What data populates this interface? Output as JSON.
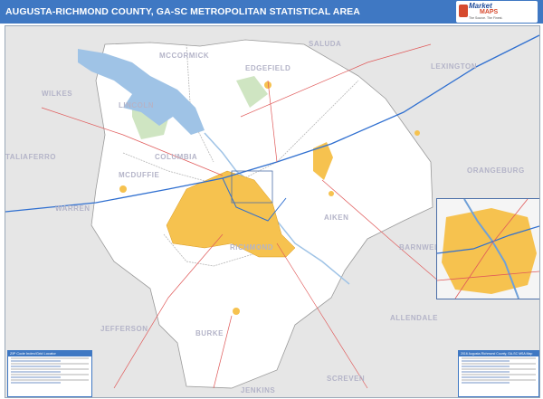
{
  "header": {
    "title": "AUGUSTA-RICHMOND COUNTY, GA-SC METROPOLITAN STATISTICAL AREA"
  },
  "logo": {
    "word1": "Market",
    "word2": "MAPS",
    "tagline": "The Source. The Finest.",
    "brand_color": "#234f9c",
    "accent_color": "#d64a2e"
  },
  "colors": {
    "title_bar": "#3f78c3",
    "msa_counties": "#ffffff",
    "outside_counties": "#e6e6e6",
    "urban_area": "#f6c24f",
    "water": "#9fc3e6",
    "forest": "#cfe5c2",
    "interstate": "#2f6fd0",
    "highway": "#e05a5a"
  },
  "map": {
    "counties_outside": [
      {
        "id": "mccormick",
        "label": "MCCORMICK"
      },
      {
        "id": "saluda",
        "label": "SALUDA"
      },
      {
        "id": "lexington",
        "label": "LEXINGTON"
      },
      {
        "id": "wilkes",
        "label": "WILKES"
      },
      {
        "id": "taliaferro",
        "label": "TALIAFERRO"
      },
      {
        "id": "warren",
        "label": "WARREN"
      },
      {
        "id": "orangeburg",
        "label": "ORANGEBURG"
      },
      {
        "id": "barnwell",
        "label": "BARNWELL"
      },
      {
        "id": "allendale",
        "label": "ALLENDALE"
      },
      {
        "id": "jefferson",
        "label": "JEFFERSON"
      },
      {
        "id": "screven",
        "label": "SCREVEN"
      },
      {
        "id": "jenkins",
        "label": "JENKINS"
      },
      {
        "id": "lincoln",
        "label": "LINCOLN"
      }
    ],
    "counties_msa": [
      {
        "id": "edgefield",
        "label": "EDGEFIELD"
      },
      {
        "id": "columbia",
        "label": "COLUMBIA"
      },
      {
        "id": "mcduffie",
        "label": "MCDUFFIE"
      },
      {
        "id": "richmond",
        "label": "RICHMOND"
      },
      {
        "id": "aiken",
        "label": "AIKEN"
      },
      {
        "id": "burke",
        "label": "BURKE"
      }
    ]
  },
  "legend_left": {
    "heading": "ZIP Code Index/Grid Locator"
  },
  "legend_right": {
    "heading": "2016 Augusta-Richmond County, GA-SC MSA Map"
  }
}
